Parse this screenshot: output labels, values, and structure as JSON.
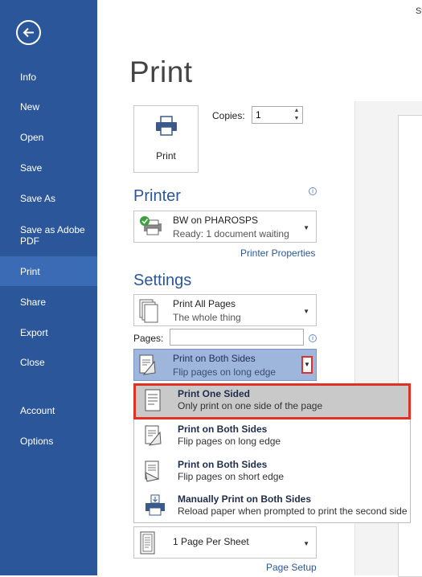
{
  "sidebar": {
    "items": [
      {
        "label": "Info"
      },
      {
        "label": "New"
      },
      {
        "label": "Open"
      },
      {
        "label": "Save"
      },
      {
        "label": "Save As"
      },
      {
        "label": "Save as Adobe PDF"
      },
      {
        "label": "Print"
      },
      {
        "label": "Share"
      },
      {
        "label": "Export"
      },
      {
        "label": "Close"
      },
      {
        "label": "Account"
      },
      {
        "label": "Options"
      }
    ],
    "active": "Print"
  },
  "header": {
    "title": "Print",
    "top_right_text": "St"
  },
  "print_button": {
    "label": "Print"
  },
  "copies": {
    "label": "Copies:",
    "value": "1"
  },
  "printer": {
    "section_title": "Printer",
    "name": "BW on PHAROSPS",
    "status": "Ready: 1 document waiting",
    "properties_link": "Printer Properties"
  },
  "settings": {
    "section_title": "Settings",
    "range": {
      "title": "Print All Pages",
      "subtitle": "The whole thing"
    },
    "pages_label": "Pages:",
    "pages_value": "",
    "sides": {
      "title": "Print on Both Sides",
      "subtitle": "Flip pages on long edge"
    },
    "per_sheet": {
      "title": "1 Page Per Sheet"
    },
    "page_setup_link": "Page Setup"
  },
  "menu": {
    "items": [
      {
        "title": "Print One Sided",
        "subtitle": "Only print on one side of the page"
      },
      {
        "title": "Print on Both Sides",
        "subtitle": "Flip pages on long edge"
      },
      {
        "title": "Print on Both Sides",
        "subtitle": "Flip pages on short edge"
      },
      {
        "title": "Manually Print on Both Sides",
        "subtitle": "Reload paper when prompted to print the second side"
      }
    ]
  },
  "colors": {
    "accent": "#2b579a",
    "highlight": "#e03126"
  }
}
